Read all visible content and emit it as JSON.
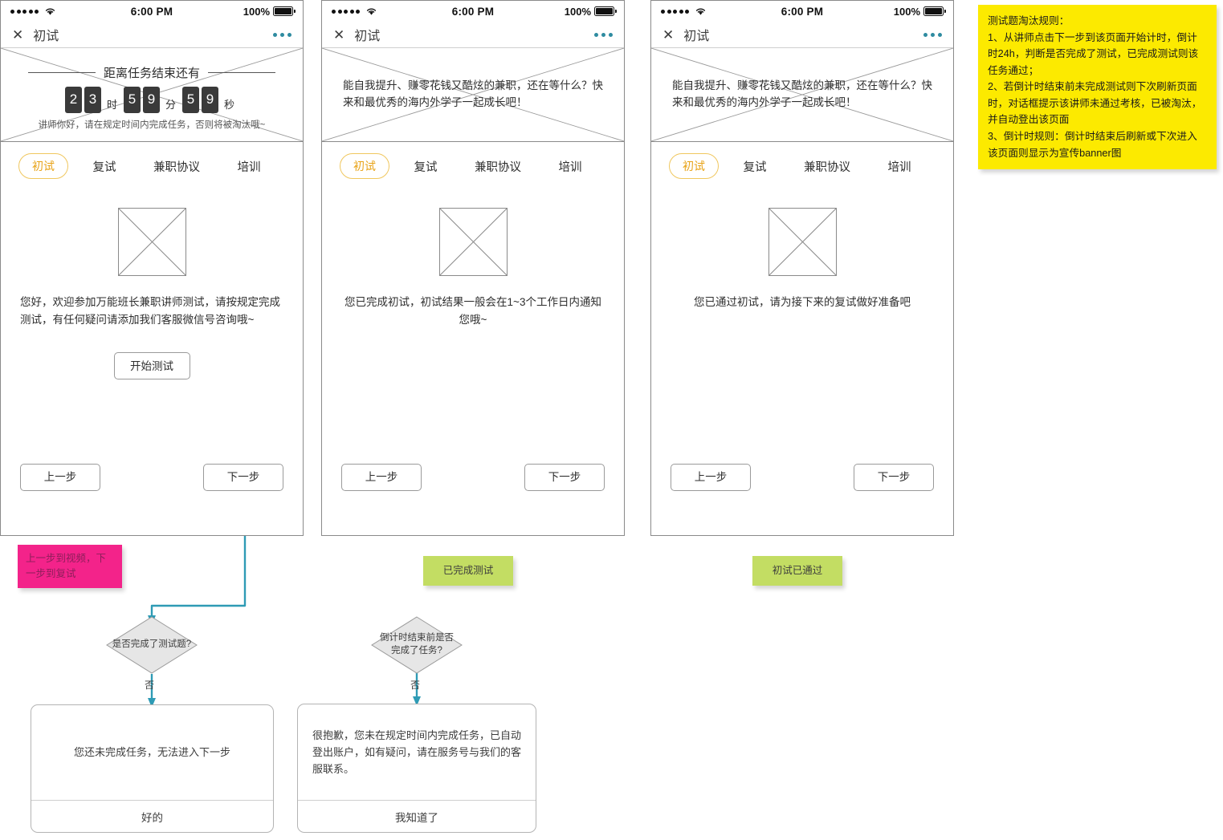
{
  "status_bar": {
    "signal_dots": 5,
    "wifi_icon": "wifi-icon",
    "time": "6:00 PM",
    "battery_percent": "100%",
    "battery_icon": "battery-full-icon"
  },
  "title_bar": {
    "close_icon": "close-x-icon",
    "title": "初试",
    "more_icon": "more-dots-icon"
  },
  "screen1": {
    "countdown": {
      "label": "距离任务结束还有",
      "hours": [
        "2",
        "3"
      ],
      "hours_unit": "时",
      "minutes": [
        "5",
        "9"
      ],
      "minutes_unit": "分",
      "seconds": [
        "5",
        "9"
      ],
      "seconds_unit": "秒",
      "note": "讲师你好，请在规定时间内完成任务，否则将被淘汰哦~"
    },
    "tabs": [
      {
        "label": "初试",
        "active": true
      },
      {
        "label": "复试",
        "active": false
      },
      {
        "label": "兼职协议",
        "active": false
      },
      {
        "label": "培训",
        "active": false
      }
    ],
    "image_placeholder": "image-placeholder-icon",
    "body_text": "您好，欢迎参加万能班长兼职讲师测试，请按规定完成测试，有任何疑问请添加我们客服微信号咨询哦~",
    "start_button": "开始测试",
    "prev_button": "上一步",
    "next_button": "下一步"
  },
  "screen2": {
    "banner_text": "能自我提升、赚零花钱又酷炫的兼职，还在等什么？快来和最优秀的海内外学子一起成长吧！",
    "tabs": [
      {
        "label": "初试",
        "active": true
      },
      {
        "label": "复试",
        "active": false
      },
      {
        "label": "兼职协议",
        "active": false
      },
      {
        "label": "培训",
        "active": false
      }
    ],
    "image_placeholder": "image-placeholder-icon",
    "body_text": "您已完成初试，初试结果一般会在1~3个工作日内通知您哦~",
    "prev_button": "上一步",
    "next_button": "下一步"
  },
  "screen3": {
    "banner_text": "能自我提升、赚零花钱又酷炫的兼职，还在等什么？快来和最优秀的海内外学子一起成长吧！",
    "tabs": [
      {
        "label": "初试",
        "active": true
      },
      {
        "label": "复试",
        "active": false
      },
      {
        "label": "兼职协议",
        "active": false
      },
      {
        "label": "培训",
        "active": false
      }
    ],
    "image_placeholder": "image-placeholder-icon",
    "body_text": "您已通过初试，请为接下来的复试做好准备吧",
    "prev_button": "上一步",
    "next_button": "下一步"
  },
  "notes": {
    "pink": "上一步到视频，下一步到复试",
    "green1": "已完成测试",
    "green2": "初试已通过",
    "yellow": "测试题淘汰规则：\n1、从讲师点击下一步到该页面开始计时，倒计时24h，判断是否完成了测试，已完成测试则该任务通过；\n2、若倒计时结束前未完成测试则下次刷新页面时，对话框提示该讲师未通过考核，已被淘汰，并自动登出该页面\n3、倒计时规则：倒计时结束后刷新或下次进入该页面则显示为宣传banner图"
  },
  "flow": {
    "decision1": "是否完成了测试题?",
    "decision1_edge": "否",
    "dialog1_body": "您还未完成任务，无法进入下一步",
    "dialog1_action": "好的",
    "decision2": "倒计时结束前是否完成了任务?",
    "decision2_edge": "否",
    "dialog2_body": "很抱歉，您未在规定时间内完成任务，已自动登出账户，如有疑问，请在服务号与我们的客服联系。",
    "dialog2_action": "我知道了"
  },
  "colors": {
    "accent_tab": "#e8a317",
    "tab_border": "#f0c75e",
    "connector": "#2e9bb5",
    "note_pink": "#f3238a",
    "note_green": "#c3dd63",
    "note_yellow": "#fcea00",
    "countdown_box": "#3a3a3a"
  }
}
